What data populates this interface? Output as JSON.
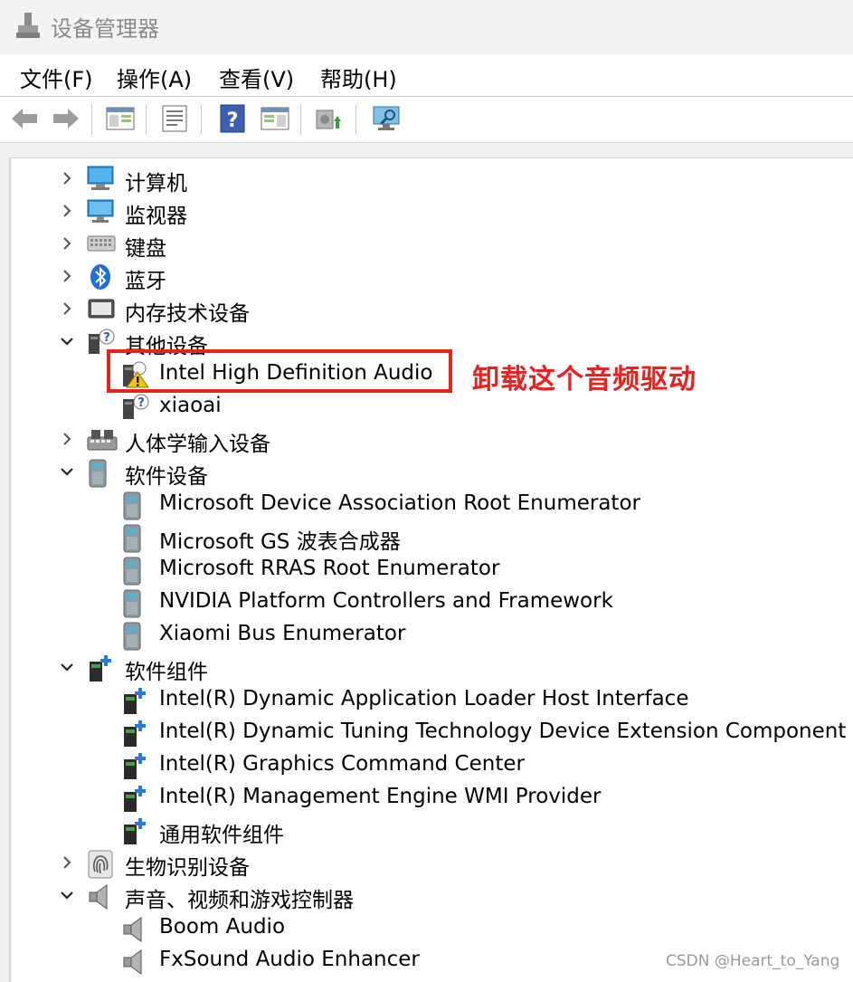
{
  "window": {
    "title": "设备管理器",
    "icon": "device-manager-icon"
  },
  "menu": [
    {
      "label": "文件(F)"
    },
    {
      "label": "操作(A)"
    },
    {
      "label": "查看(V)"
    },
    {
      "label": "帮助(H)"
    }
  ],
  "toolbar": [
    {
      "icon": "back-arrow-icon"
    },
    {
      "icon": "forward-arrow-icon"
    },
    {
      "icon": "show-hide-console-tree-icon"
    },
    {
      "icon": "properties-icon"
    },
    {
      "icon": "help-icon"
    },
    {
      "icon": "show-action-pane-icon"
    },
    {
      "icon": "update-driver-icon"
    },
    {
      "icon": "scan-hardware-changes-icon"
    }
  ],
  "tree": [
    {
      "label": "计算机",
      "expander": "collapsed",
      "icon": "computer-icon",
      "level": 1
    },
    {
      "label": "监视器",
      "expander": "collapsed",
      "icon": "monitor-icon",
      "level": 1
    },
    {
      "label": "键盘",
      "expander": "collapsed",
      "icon": "keyboard-icon",
      "level": 1
    },
    {
      "label": "蓝牙",
      "expander": "collapsed",
      "icon": "bluetooth-icon",
      "level": 1
    },
    {
      "label": "内存技术设备",
      "expander": "collapsed",
      "icon": "memory-device-icon",
      "level": 1
    },
    {
      "label": "其他设备",
      "expander": "expanded",
      "icon": "unknown-device-icon",
      "level": 1
    },
    {
      "label": "Intel High Definition Audio",
      "icon": "device-warning-icon",
      "level": 2
    },
    {
      "label": "xiaoai",
      "icon": "unknown-device-icon",
      "level": 2
    },
    {
      "label": "人体学输入设备",
      "expander": "collapsed",
      "icon": "hid-icon",
      "level": 1
    },
    {
      "label": "软件设备",
      "expander": "expanded",
      "icon": "software-device-icon",
      "level": 1
    },
    {
      "label": "Microsoft Device Association Root Enumerator",
      "icon": "software-device-icon",
      "level": 2
    },
    {
      "label": "Microsoft GS 波表合成器",
      "icon": "software-device-icon",
      "level": 2
    },
    {
      "label": "Microsoft RRAS Root Enumerator",
      "icon": "software-device-icon",
      "level": 2
    },
    {
      "label": "NVIDIA Platform Controllers and Framework",
      "icon": "software-device-icon",
      "level": 2
    },
    {
      "label": "Xiaomi Bus Enumerator",
      "icon": "software-device-icon",
      "level": 2
    },
    {
      "label": "软件组件",
      "expander": "expanded",
      "icon": "software-component-icon",
      "level": 1
    },
    {
      "label": "Intel(R) Dynamic Application Loader Host Interface",
      "icon": "software-component-icon",
      "level": 2
    },
    {
      "label": "Intel(R) Dynamic Tuning Technology Device Extension Component",
      "icon": "software-component-icon",
      "level": 2
    },
    {
      "label": "Intel(R) Graphics Command Center",
      "icon": "software-component-icon",
      "level": 2
    },
    {
      "label": "Intel(R) Management Engine WMI Provider",
      "icon": "software-component-icon",
      "level": 2
    },
    {
      "label": "通用软件组件",
      "icon": "software-component-icon",
      "level": 2
    },
    {
      "label": "生物识别设备",
      "expander": "collapsed",
      "icon": "fingerprint-icon",
      "level": 1
    },
    {
      "label": "声音、视频和游戏控制器",
      "expander": "expanded",
      "icon": "speaker-icon",
      "level": 1
    },
    {
      "label": "Boom Audio",
      "icon": "speaker-icon",
      "level": 2
    },
    {
      "label": "FxSound Audio Enhancer",
      "icon": "speaker-icon",
      "level": 2
    }
  ],
  "annotation": {
    "text": "卸载这个音频驱动",
    "color": "#e8231e"
  },
  "watermark": "CSDN @Heart_to_Yang",
  "colors": {
    "highlight": "#e8231e",
    "title_text": "#8a8a8a"
  }
}
